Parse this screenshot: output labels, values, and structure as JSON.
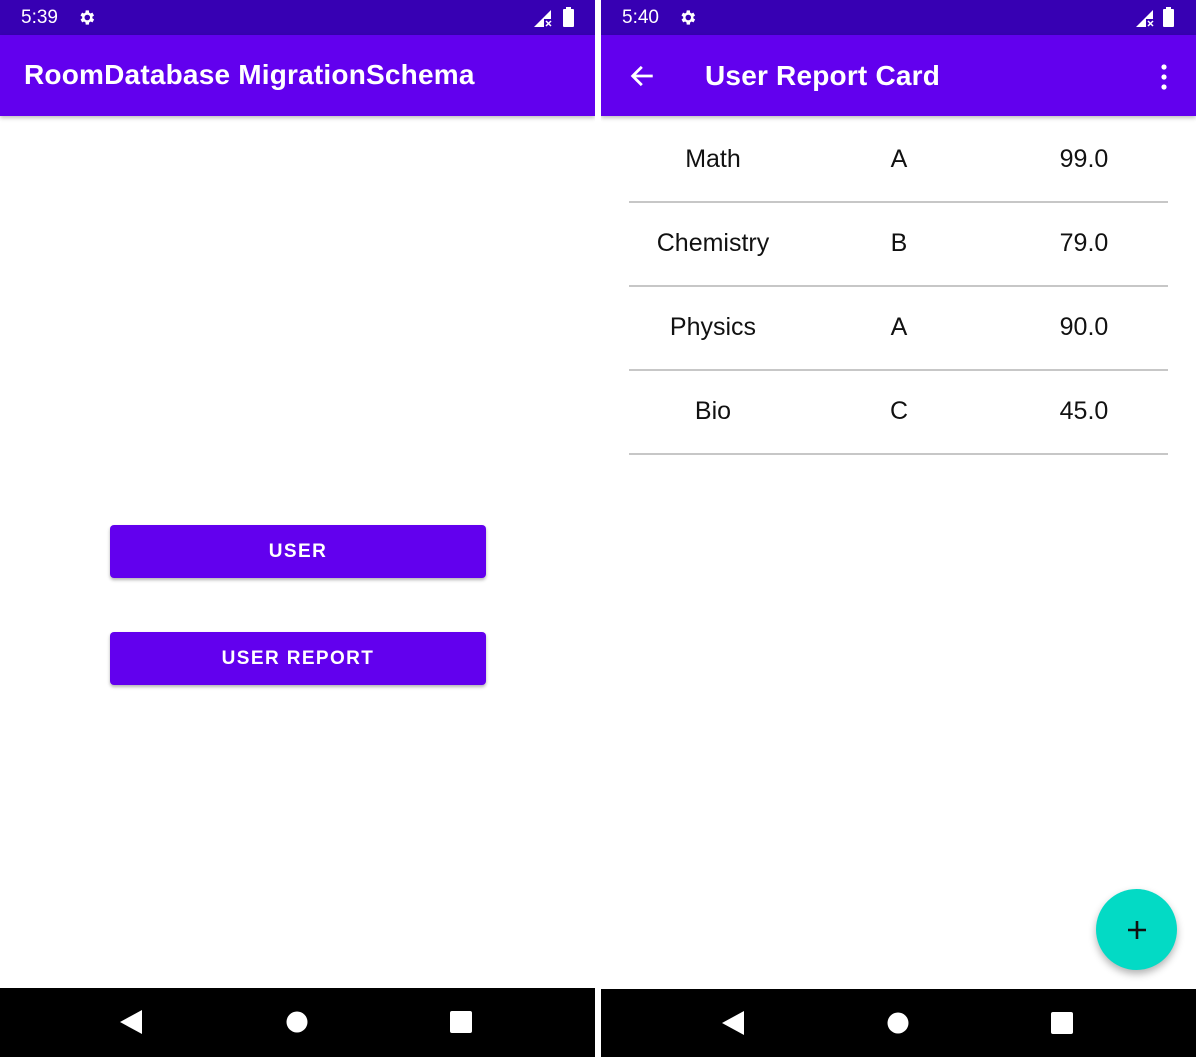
{
  "left_screen": {
    "status_bar": {
      "time": "5:39",
      "icons": [
        "settings-gear-icon",
        "signal-icon",
        "battery-icon"
      ]
    },
    "app_bar": {
      "title": "RoomDatabase MigrationSchema"
    },
    "buttons": {
      "user_label": "USER",
      "user_report_label": "USER REPORT"
    },
    "nav_bar": {
      "icons": [
        "back-nav-icon",
        "home-nav-icon",
        "recents-nav-icon"
      ]
    }
  },
  "right_screen": {
    "status_bar": {
      "time": "5:40",
      "icons": [
        "settings-gear-icon",
        "signal-icon",
        "battery-icon"
      ]
    },
    "app_bar": {
      "title": "User Report Card",
      "icons": [
        "back-arrow-icon",
        "overflow-menu-icon"
      ]
    },
    "report_rows": [
      {
        "subject": "Math",
        "grade": "A",
        "score": "99.0"
      },
      {
        "subject": "Chemistry",
        "grade": "B",
        "score": "79.0"
      },
      {
        "subject": "Physics",
        "grade": "A",
        "score": "90.0"
      },
      {
        "subject": "Bio",
        "grade": "C",
        "score": "45.0"
      }
    ],
    "fab": {
      "icon": "plus-icon"
    },
    "nav_bar": {
      "icons": [
        "back-nav-icon",
        "home-nav-icon",
        "recents-nav-icon"
      ]
    }
  },
  "colors": {
    "status_bar": "#3700b3",
    "primary": "#6200ee",
    "accent_fab": "#03dac5",
    "nav_bar": "#000000",
    "row_divider": "#c7c7c7"
  }
}
